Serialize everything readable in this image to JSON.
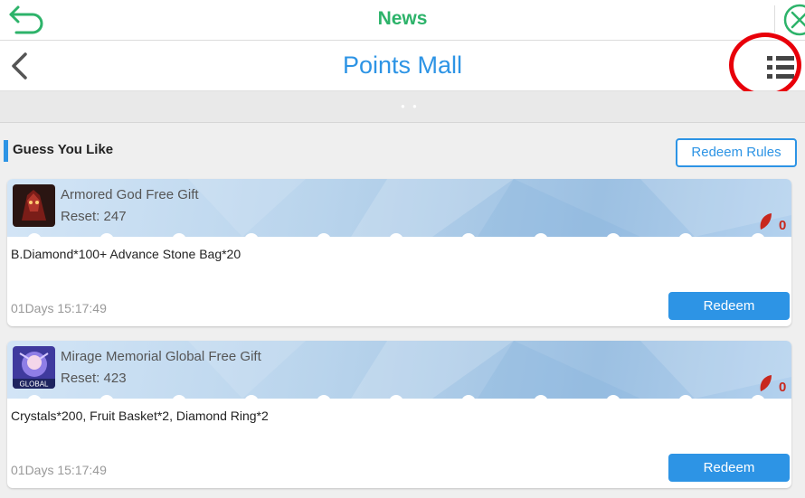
{
  "topbar": {
    "title": "News"
  },
  "header": {
    "title": "Points Mall"
  },
  "section": {
    "title": "Guess You Like",
    "rules_label": "Redeem Rules"
  },
  "cards": [
    {
      "name": "Armored God Free Gift",
      "reset": "Reset: 247",
      "points": "0",
      "description": "B.Diamond*100+ Advance Stone Bag*20",
      "timer": "01Days 15:17:49",
      "button": "Redeem",
      "icon": "game-icon-armored-god"
    },
    {
      "name": "Mirage Memorial Global Free Gift",
      "reset": "Reset: 423",
      "points": "0",
      "description": "Crystals*200, Fruit Basket*2, Diamond Ring*2",
      "timer": "01Days 15:17:49",
      "button": "Redeem",
      "icon": "game-icon-mirage-memorial"
    }
  ],
  "colors": {
    "accent": "#2d94e5",
    "news": "#2db36a",
    "highlight": "#e8000a",
    "points": "#c8281e"
  }
}
